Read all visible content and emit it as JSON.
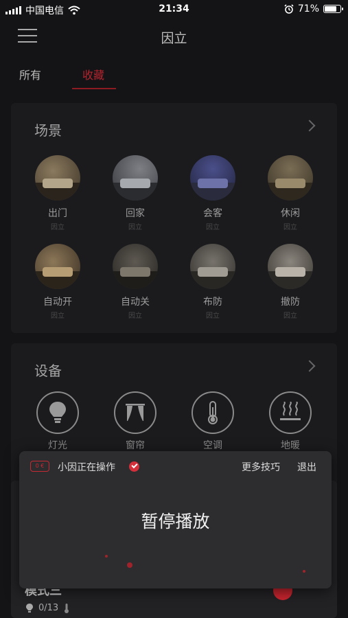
{
  "status_bar": {
    "carrier": "中国电信",
    "time": "21:34",
    "battery": "71%"
  },
  "header": {
    "title": "因立"
  },
  "tabs": [
    {
      "label": "所有"
    },
    {
      "label": "收藏"
    }
  ],
  "scenes": {
    "title": "场景",
    "items": [
      {
        "name": "出门",
        "sub": "因立",
        "icon": "scene-photo"
      },
      {
        "name": "回家",
        "sub": "因立",
        "icon": "scene-photo"
      },
      {
        "name": "会客",
        "sub": "因立",
        "icon": "scene-photo"
      },
      {
        "name": "休闲",
        "sub": "因立",
        "icon": "scene-photo"
      },
      {
        "name": "自动开",
        "sub": "因立",
        "icon": "scene-photo"
      },
      {
        "name": "自动关",
        "sub": "因立",
        "icon": "scene-photo"
      },
      {
        "name": "布防",
        "sub": "因立",
        "icon": "scene-photo"
      },
      {
        "name": "撤防",
        "sub": "因立",
        "icon": "scene-photo"
      }
    ]
  },
  "devices": {
    "title": "设备",
    "items": [
      {
        "name": "灯光",
        "icon": "bulb-icon"
      },
      {
        "name": "窗帘",
        "icon": "curtain-icon"
      },
      {
        "name": "空调",
        "icon": "thermometer-icon"
      },
      {
        "name": "地暖",
        "icon": "floor-heating-icon"
      }
    ]
  },
  "bottom_card": {
    "title": "模式三",
    "count": "0/13"
  },
  "overlay": {
    "badge": "0 €",
    "status": "小因正在操作",
    "more_tips": "更多技巧",
    "exit": "退出",
    "message": "暂停播放"
  }
}
